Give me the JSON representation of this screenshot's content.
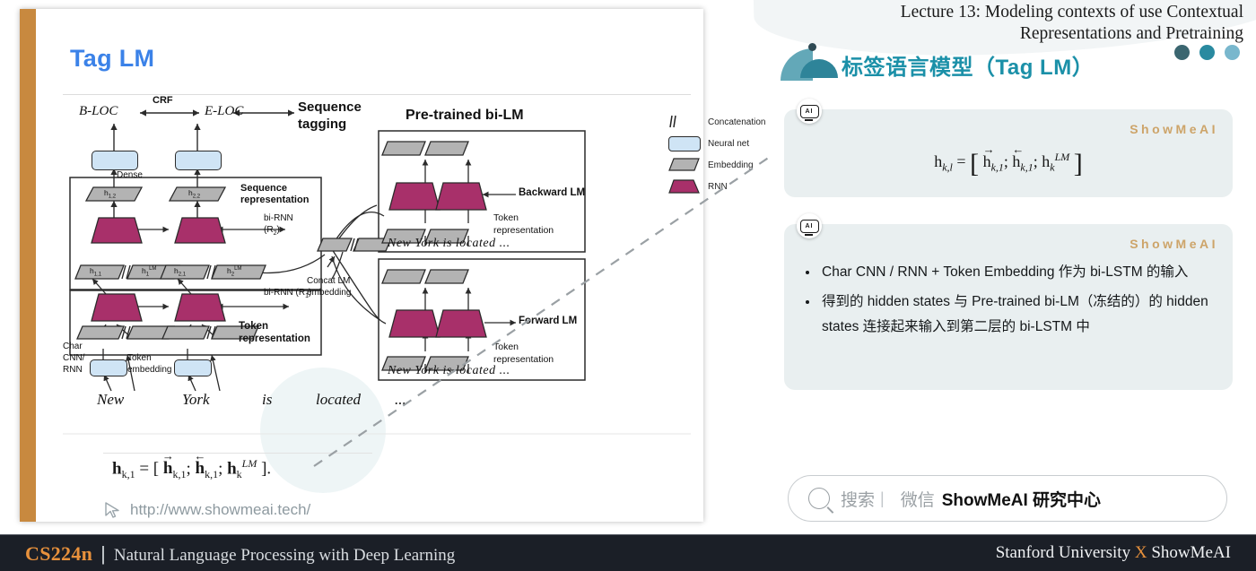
{
  "header": {
    "lecture_line1": "Lecture 13: Modeling contexts of use Contextual",
    "lecture_line2": "Representations and Pretraining",
    "cn_title": "标签语言模型（Tag LM）",
    "dot_colors": [
      "#3b6670",
      "#2a8aa0",
      "#79b7cd"
    ],
    "deco_colors": {
      "quarter": "#63a8b8",
      "semi": "#2e8499",
      "dot": "#2f4a54"
    }
  },
  "slide": {
    "title": "Tag LM",
    "title_color": "#3b82e8",
    "accent_bar_color": "#c8893f",
    "formula": "h_{k,1} = [ h⃗_{k,1} ; h⃖_{k,1} ; h_k^{LM} ].",
    "url": "http://www.showmeai.tech/",
    "diagram": {
      "tags": [
        "B-LOC",
        "E-LOC"
      ],
      "crf_label": "CRF",
      "sequence_tagging_label_1": "Sequence",
      "sequence_tagging_label_2": "tagging",
      "dense_label": "Dense",
      "seq_rep_label_1": "Sequence",
      "seq_rep_label_2": "representation",
      "birnn2_label_1": "bi-RNN",
      "birnn2_label_2": "(R",
      "birnn2_label_3": ")",
      "birnn1_label": "bi-RNN (R",
      "hidden_units": [
        "h1,2",
        "h2,2",
        "h1,1",
        "h1LM",
        "h2,1",
        "h2LM"
      ],
      "char_cnn_rnn": [
        "Char",
        "CNN/",
        "RNN"
      ],
      "token_embedding_1": "Token",
      "token_embedding_2": "embedding",
      "token_rep_label_1": "Token",
      "token_rep_label_2": "representation",
      "words": [
        "New",
        "York",
        "is",
        "located",
        "..."
      ],
      "concat_lm_1": "Concat LM",
      "concat_lm_2": "embedding",
      "pretrained_title": "Pre-trained bi-LM",
      "backward_lm": "Backward LM",
      "forward_lm": "Forward LM",
      "lm_token_rep_1": "Token",
      "lm_token_rep_2": "representation",
      "lm_words": "New    York   is  located   ...",
      "legend": [
        {
          "key": "concat",
          "label": "Concatenation"
        },
        {
          "key": "neural-net",
          "label": "Neural net",
          "color": "#cfe4f5"
        },
        {
          "key": "embedding",
          "label": "Embedding",
          "color": "#b3b3b3"
        },
        {
          "key": "rnn",
          "label": "RNN",
          "color": "#a8306a"
        }
      ]
    }
  },
  "cards": [
    {
      "watermark": "ShowMeAI",
      "badge_text": "AI",
      "formula": "h_{k,l} = [ h⃗_{k,1} ; h⃖_{k,1} ; h_k^{LM} ]"
    },
    {
      "watermark": "ShowMeAI",
      "badge_text": "AI",
      "bullets": [
        "Char CNN / RNN + Token Embedding 作为 bi-LSTM 的输入",
        "得到的 hidden states 与 Pre-trained bi-LM（冻结的）的 hidden states 连接起来输入到第二层的 bi-LSTM 中"
      ]
    }
  ],
  "searchbar": {
    "placeholder_gray": "搜索",
    "separator": "|",
    "wechat": "微信",
    "brand": "ShowMeAI 研究中心"
  },
  "footer": {
    "course": "CS224n",
    "divider": "|",
    "subtitle": "Natural Language Processing with Deep Learning",
    "right_pre": "Stanford University ",
    "right_x": "X",
    "right_post": " ShowMeAI",
    "accent": "#e8913c"
  }
}
